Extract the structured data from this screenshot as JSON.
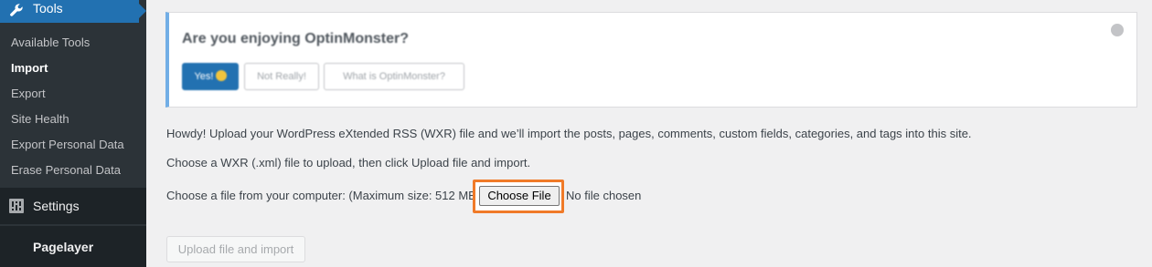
{
  "sidebar": {
    "tools_label": "Tools",
    "items": [
      {
        "label": "Available Tools",
        "current": false
      },
      {
        "label": "Import",
        "current": true
      },
      {
        "label": "Export",
        "current": false
      },
      {
        "label": "Site Health",
        "current": false
      },
      {
        "label": "Export Personal Data",
        "current": false
      },
      {
        "label": "Erase Personal Data",
        "current": false
      }
    ],
    "settings_label": "Settings",
    "pagelayer_label": "Pagelayer"
  },
  "notice": {
    "title": "Are you enjoying OptinMonster?",
    "yes_label": "Yes!",
    "not_really_label": "Not Really!",
    "what_is_label": "What is OptinMonster?"
  },
  "main": {
    "intro": "Howdy! Upload your WordPress eXtended RSS (WXR) file and we’ll import the posts, pages, comments, custom fields, categories, and tags into this site.",
    "instruction": "Choose a WXR (.xml) file to upload, then click Upload file and import.",
    "file_label": "Choose a file from your computer: (Maximum size: 512 MB",
    "choose_file_label": "Choose File",
    "no_file_label": "No file chosen",
    "upload_label": "Upload file and import"
  },
  "colors": {
    "accent": "#2271b1",
    "sidebar_bg": "#2c3338",
    "highlight": "#f07a28",
    "notice_border": "#72aee6"
  }
}
